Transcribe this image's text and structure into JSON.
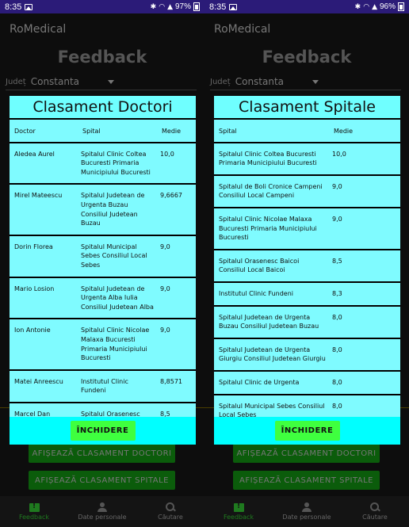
{
  "status_left": {
    "time": "8:35",
    "battery": "97%"
  },
  "status_right": {
    "time": "8:35",
    "battery": "96%"
  },
  "app": {
    "name": "RoMedical"
  },
  "background": {
    "title": "Feedback",
    "judet_label": "Județ",
    "judet_value": "Constanta",
    "btn_doctori": "AFIȘEAZĂ CLASAMENT DOCTORI",
    "btn_spitale": "AFIȘEAZĂ CLASAMENT SPITALE"
  },
  "nav": {
    "feedback": "Feedback",
    "date": "Date personale",
    "cautare": "Căutare"
  },
  "doctors_dialog": {
    "title": "Clasament Doctori",
    "headers": {
      "doctor": "Doctor",
      "spital": "Spital",
      "medie": "Medie"
    },
    "rows": [
      {
        "doctor": "Aledea Aurel",
        "spital": "Spitalul Clinic Coltea Bucuresti Primaria Municipiului Bucuresti",
        "medie": "10,0"
      },
      {
        "doctor": "Mirel Mateescu",
        "spital": "Spitalul Judetean de Urgenta Buzau Consiliul Judetean Buzau",
        "medie": "9,6667"
      },
      {
        "doctor": "Dorin Florea",
        "spital": "Spitalul Municipal Sebes Consiliul Local Sebes",
        "medie": "9,0"
      },
      {
        "doctor": "Mario Losion",
        "spital": "Spitalul Judetean de Urgenta Alba Iulia Consiliul Judetean Alba",
        "medie": "9,0"
      },
      {
        "doctor": "Ion Antonie",
        "spital": "Spitalul Clinic Nicolae Malaxa Bucuresti Primaria Municipiului Bucuresti",
        "medie": "9,0"
      },
      {
        "doctor": "Matei Anreescu",
        "spital": "Institutul Clinic Fundeni",
        "medie": "8,8571"
      },
      {
        "doctor": "Marcel Dan",
        "spital": "Spitalul Orasenesc",
        "medie": "8,5"
      }
    ],
    "close_label": "ÎNCHIDERE"
  },
  "hospitals_dialog": {
    "title": "Clasament Spitale",
    "headers": {
      "spital": "Spital",
      "medie": "Medie"
    },
    "rows": [
      {
        "spital": "Spitalul Clinic Coltea Bucuresti Primaria Municipiului Bucuresti",
        "medie": "10,0"
      },
      {
        "spital": "Spitalul de Boli Cronice Campeni Consiliul Local Campeni",
        "medie": "9,0"
      },
      {
        "spital": "Spitalul Clinic Nicolae Malaxa Bucuresti Primaria Municipiului Bucuresti",
        "medie": "9,0"
      },
      {
        "spital": "Spitalul Orasenesc Baicoi Consiliul Local Baicoi",
        "medie": "8,5"
      },
      {
        "spital": "Institutul Clinic Fundeni",
        "medie": "8,3"
      },
      {
        "spital": "Spitalul Judetean de Urgenta Buzau Consiliul Judetean Buzau",
        "medie": "8,0"
      },
      {
        "spital": "Spitalul Judetean de Urgenta Giurgiu Consiliul Judetean Giurgiu",
        "medie": "8,0"
      },
      {
        "spital": "Spitalul Clinic de Urgenta",
        "medie": "8,0"
      },
      {
        "spital": "Spitalul Municipal Sebes Consiliul Local Sebes",
        "medie": "8,0"
      }
    ],
    "close_label": "ÎNCHIDERE"
  },
  "colors": {
    "dialog_bg": "#7ffbff",
    "dialog_footer": "#00ffff",
    "close_button": "#3fff3f",
    "statusbar": "#2b1b78",
    "nav_active": "#1f7a1f"
  }
}
